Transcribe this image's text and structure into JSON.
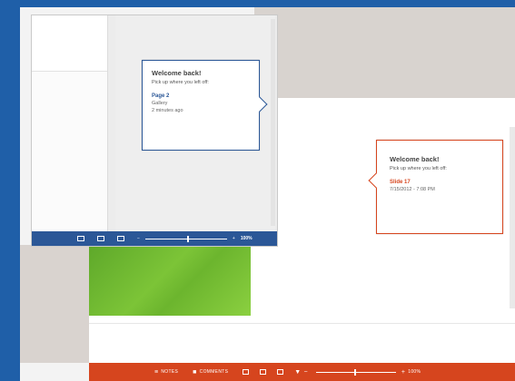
{
  "colors": {
    "desktop": "#1f5fa8",
    "word_accent": "#2b5797",
    "powerpoint_accent": "#d6451e"
  },
  "word": {
    "callout": {
      "title": "Welcome back!",
      "subtitle": "Pick up where you left off:",
      "location": "Page 2",
      "detail_line1": "Gallery",
      "detail_line2": "2 minutes ago"
    },
    "status_bar": {
      "zoom": "100%",
      "icons": [
        "read-mode-icon",
        "print-layout-icon",
        "web-layout-icon"
      ]
    }
  },
  "powerpoint": {
    "callout": {
      "title": "Welcome back!",
      "subtitle": "Pick up where you left off:",
      "location": "Slide 17",
      "detail": "7/15/2012 - 7:08 PM"
    },
    "status_bar": {
      "notes_label": "NOTES",
      "comments_label": "COMMENTS",
      "zoom": "100%",
      "icons": [
        "notes-icon",
        "comments-icon",
        "normal-view-icon",
        "slide-sorter-icon",
        "reading-view-icon",
        "slideshow-icon"
      ]
    }
  }
}
